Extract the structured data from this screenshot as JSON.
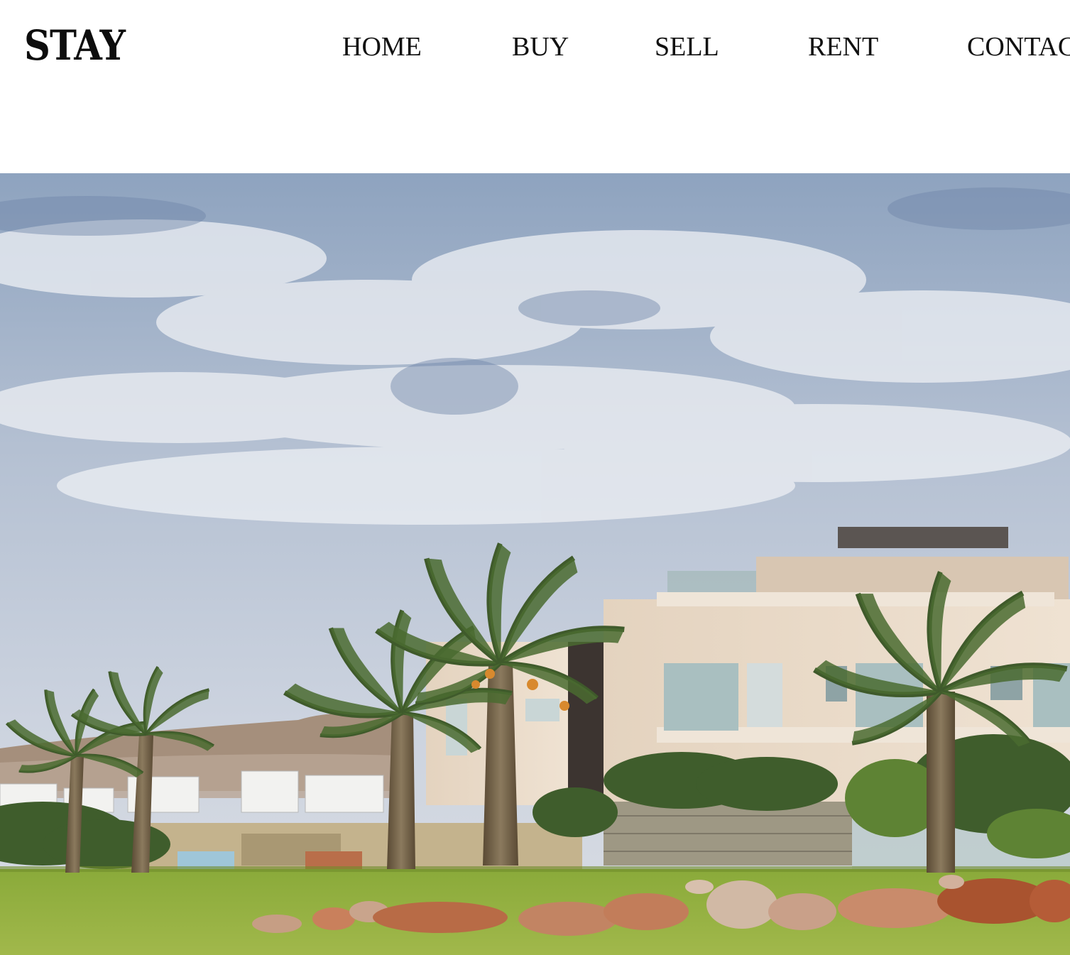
{
  "brand": {
    "logo_text": "STAY"
  },
  "nav": {
    "items": [
      {
        "label": "HOME"
      },
      {
        "label": "BUY"
      },
      {
        "label": "SELL"
      },
      {
        "label": "RENT"
      },
      {
        "label": "CONTACT"
      }
    ]
  },
  "hero": {
    "image_icon": "villa-palm-trees-photo",
    "colors": {
      "sky_top": "#7f95b4",
      "sky_bottom": "#c9d2df",
      "cloud": "#e6e9ef",
      "lawn": "#8fae3a",
      "building": "#e7d8c6",
      "palm": "#3d5a2a"
    }
  }
}
